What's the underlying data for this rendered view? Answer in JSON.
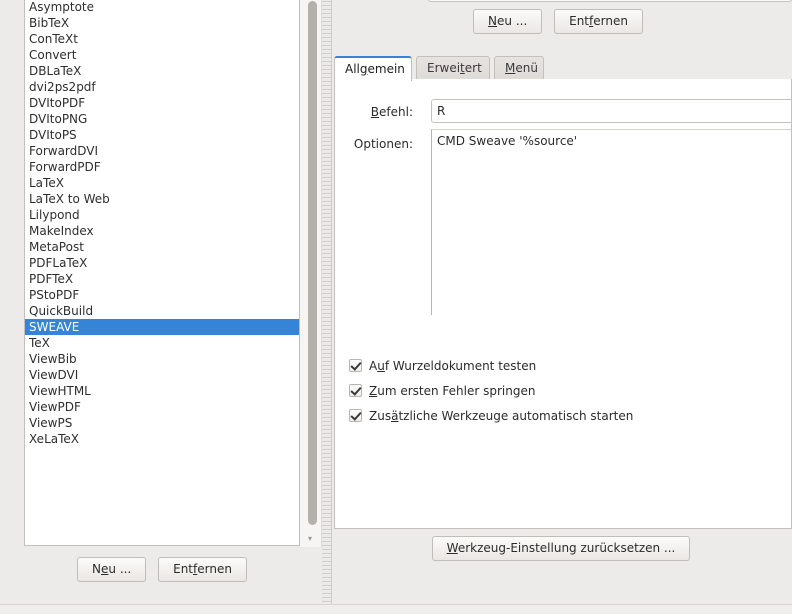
{
  "tool_list": {
    "items": [
      "Asymptote",
      "BibTeX",
      "ConTeXt",
      "Convert",
      "DBLaTeX",
      "dvi2ps2pdf",
      "DVItoPDF",
      "DVItoPNG",
      "DVItoPS",
      "ForwardDVI",
      "ForwardPDF",
      "LaTeX",
      "LaTeX to Web",
      "Lilypond",
      "MakeIndex",
      "MetaPost",
      "PDFLaTeX",
      "PDFTeX",
      "PStoPDF",
      "QuickBuild",
      "SWEAVE",
      "TeX",
      "ViewBib",
      "ViewDVI",
      "ViewHTML",
      "ViewPDF",
      "ViewPS",
      "XeLaTeX"
    ],
    "selected_index": 20,
    "selected_value": "SWEAVE",
    "selection_color": "#3584d8"
  },
  "left_buttons": {
    "new": {
      "prefix": "N",
      "mnemonic": "e",
      "suffix": "u ..."
    },
    "remove": {
      "prefix": "Ent",
      "mnemonic": "f",
      "suffix": "ernen"
    }
  },
  "top_buttons": {
    "new": {
      "prefix": "",
      "mnemonic": "N",
      "suffix": "eu ..."
    },
    "remove": {
      "prefix": "Ent",
      "mnemonic": "f",
      "suffix": "ernen"
    }
  },
  "tabs": [
    {
      "prefix": "All",
      "mnemonic": "g",
      "suffix": "emein",
      "active": true
    },
    {
      "prefix": "Erwei",
      "mnemonic": "t",
      "suffix": "ert",
      "active": false
    },
    {
      "prefix": "",
      "mnemonic": "M",
      "suffix": "enü",
      "active": false
    }
  ],
  "general_tab": {
    "command": {
      "label_prefix": "",
      "label_mnemonic": "B",
      "label_suffix": "efehl:",
      "value": "R"
    },
    "options": {
      "label_prefix": "Optionen:",
      "label_mnemonic": "",
      "label_suffix": "",
      "value": "CMD Sweave '%source'"
    },
    "checkboxes": [
      {
        "prefix": "A",
        "mnemonic": "u",
        "suffix": "f Wurzeldokument testen",
        "checked": true
      },
      {
        "prefix": "",
        "mnemonic": "Z",
        "suffix": "um ersten Fehler springen",
        "checked": true
      },
      {
        "prefix": "Zus",
        "mnemonic": "ä",
        "suffix": "tzliche Werkzeuge automatisch starten",
        "checked": true
      }
    ]
  },
  "reset_button": {
    "prefix": "",
    "mnemonic": "W",
    "suffix": "erkzeug-Einstellung zurücksetzen ..."
  },
  "icons": {
    "scroll_down_arrow": "scroll-down-arrow-icon"
  }
}
